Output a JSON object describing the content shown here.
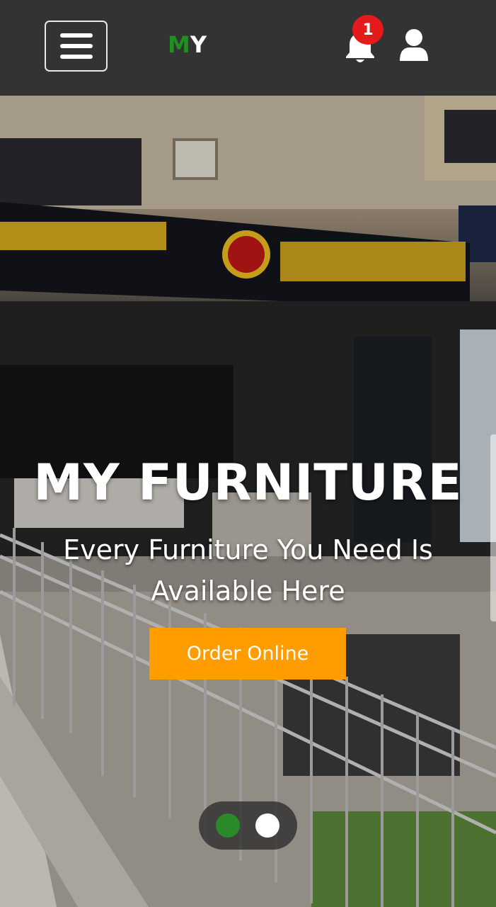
{
  "header": {
    "brand_m": "M",
    "brand_y": "Y",
    "notification_count": "1",
    "icons": [
      "menu-icon",
      "bell-icon",
      "user-icon"
    ]
  },
  "hero": {
    "title": "MY FURNITURE",
    "subtitle": "Every Furniture You Need Is Available Here",
    "cta_label": "Order Online",
    "slides_total": 2,
    "slide_active": 1
  },
  "colors": {
    "header_bg": "#333333",
    "brand_green": "#1f8f1f",
    "badge_red": "#e51a1a",
    "cta_orange": "#ff9d00"
  }
}
